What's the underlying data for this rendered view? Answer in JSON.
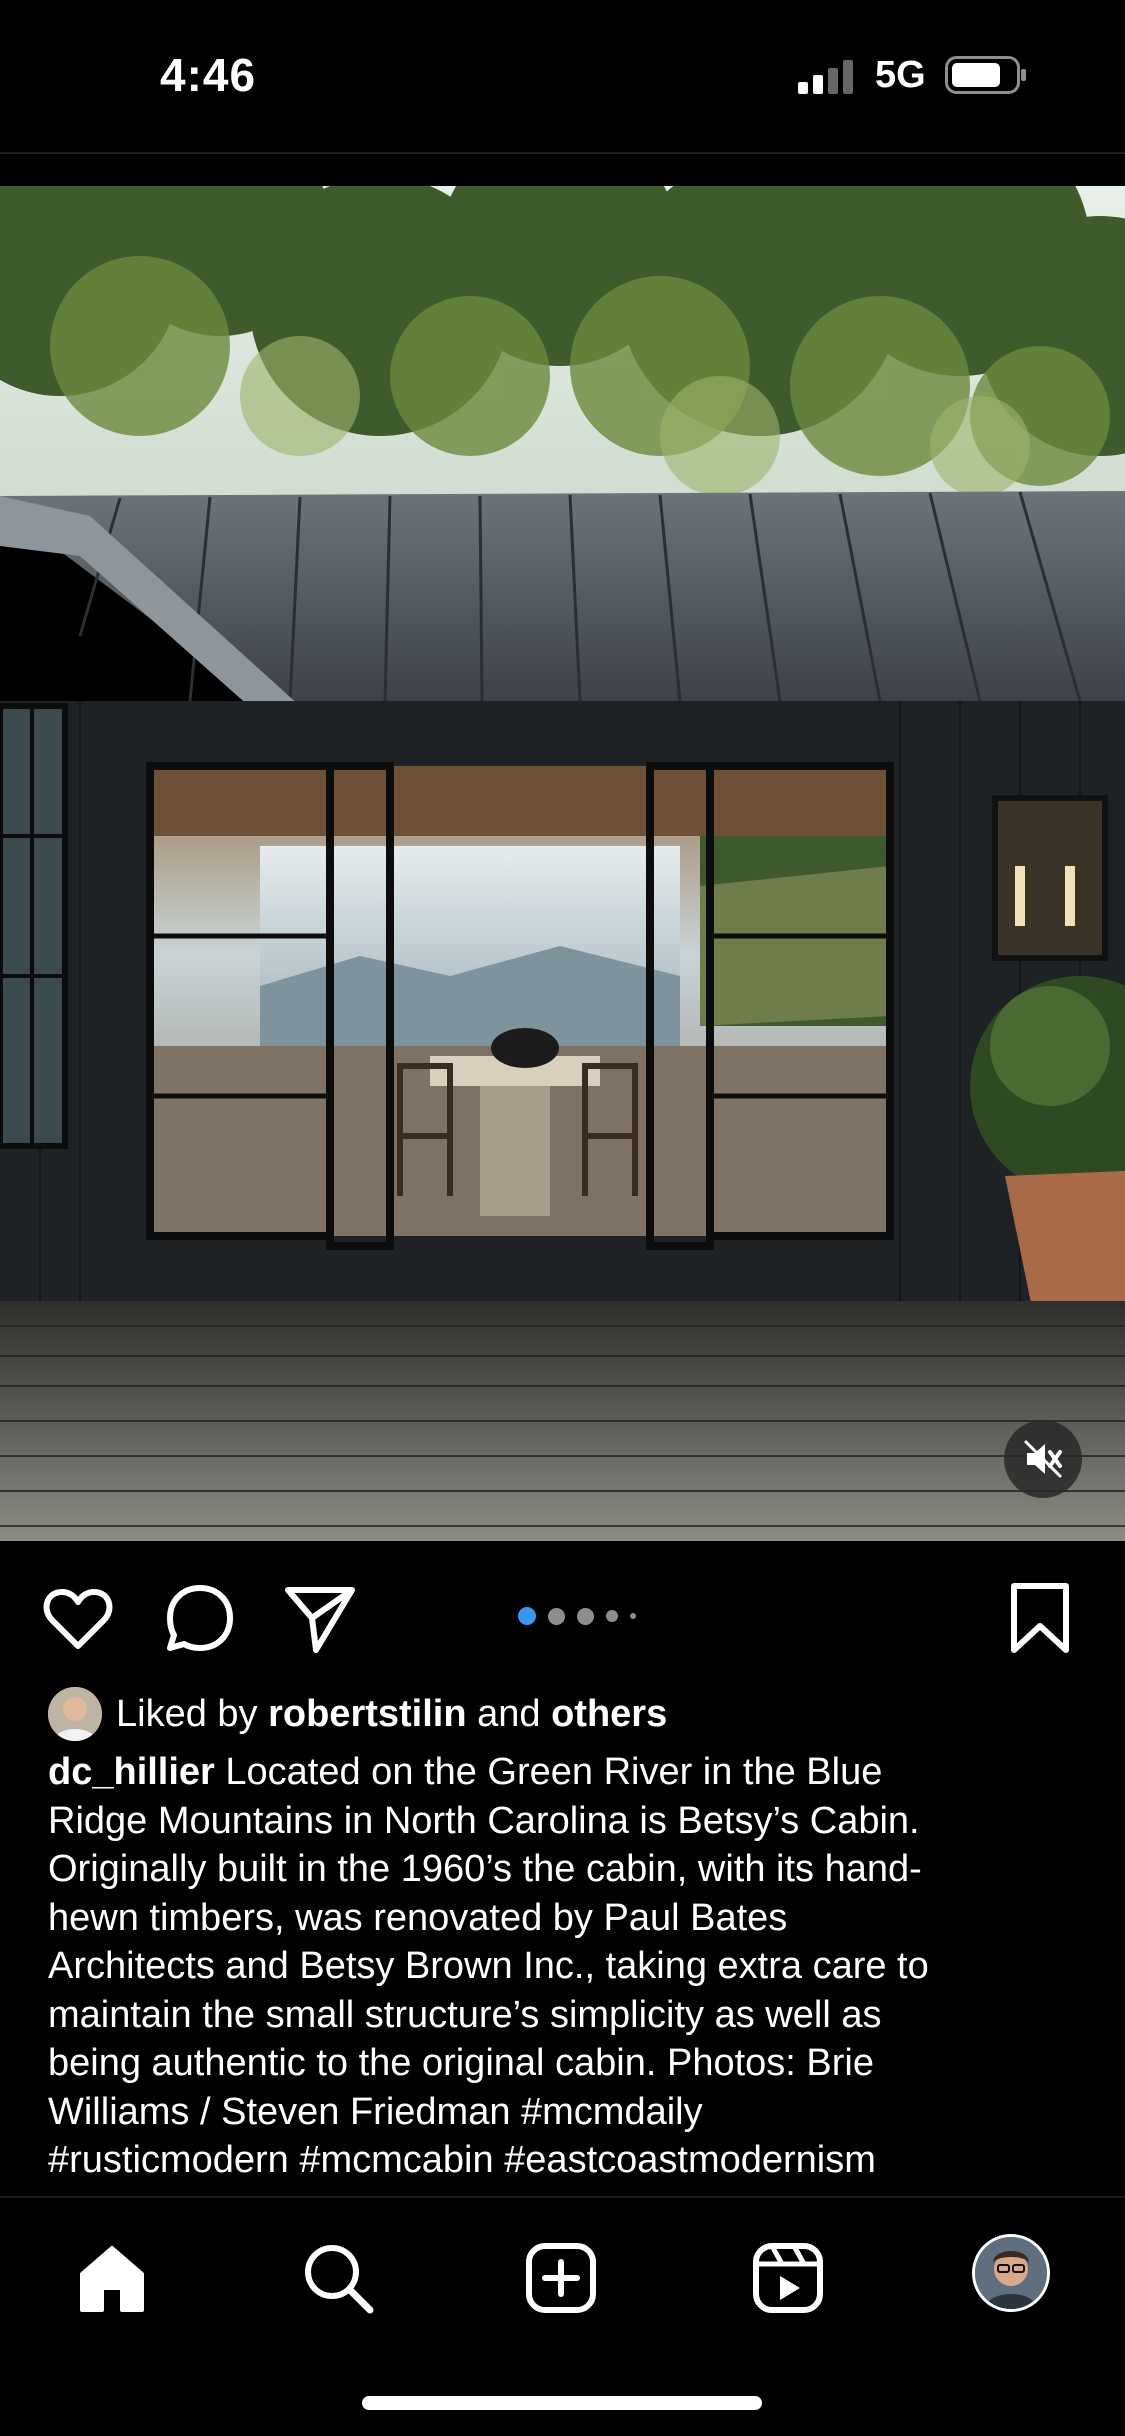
{
  "status_bar": {
    "time": "4:46",
    "network": "5G"
  },
  "post": {
    "carousel": {
      "total": 5,
      "active_index": 0
    },
    "likes": {
      "prefix": "Liked by ",
      "user": "robertstilin",
      "middle": " and ",
      "suffix": "others"
    },
    "caption": {
      "username": "dc_hillier",
      "lines": [
        " Located on the Green River in the Blue",
        "Ridge Mountains in North Carolina is Betsy’s Cabin.",
        "Originally built in the 1960’s the cabin, with its hand-",
        "hewn timbers, was renovated by Paul Bates",
        "Architects and Betsy Brown Inc., taking extra care to",
        "maintain the small structure’s simplicity as well as",
        "being authentic to the original cabin. Photos: Brie",
        "Williams / Steven Friedman #mcmdaily",
        "#rusticmodern #mcmcabin #eastcoastmodernism"
      ]
    }
  },
  "icons": {
    "like": "heart-icon",
    "comment": "comment-icon",
    "share": "paper-plane-icon",
    "save": "bookmark-icon",
    "mute": "speaker-muted-icon",
    "nav": [
      "home-icon",
      "search-icon",
      "plus-square-icon",
      "reels-icon",
      "profile-avatar"
    ]
  },
  "colors": {
    "background": "#000000",
    "text": "#ffffff",
    "carousel_active": "#3897f0",
    "carousel_inactive": "#8e8e8e"
  }
}
